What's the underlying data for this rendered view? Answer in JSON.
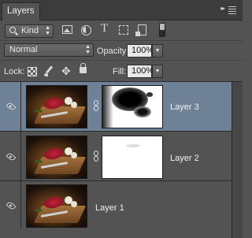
{
  "panel": {
    "tab_label": "Layers",
    "menu_glyph": "▸▸"
  },
  "filter": {
    "kind_label": "Kind"
  },
  "blending": {
    "mode": "Normal",
    "opacity_label": "Opacity:",
    "opacity_value": "100%"
  },
  "locks": {
    "lock_label": "Lock:",
    "fill_label": "Fill:",
    "fill_value": "100%"
  },
  "layers": [
    {
      "name": "Layer 3",
      "selected": true,
      "visible": true,
      "has_mask": true
    },
    {
      "name": "Layer 2",
      "selected": false,
      "visible": true,
      "has_mask": true
    },
    {
      "name": "Layer 1",
      "selected": false,
      "visible": true,
      "has_mask": false
    }
  ],
  "colors": {
    "panel_bg": "#535353",
    "selected_row": "#6f8196",
    "tab_bar": "#3c3c3c"
  }
}
